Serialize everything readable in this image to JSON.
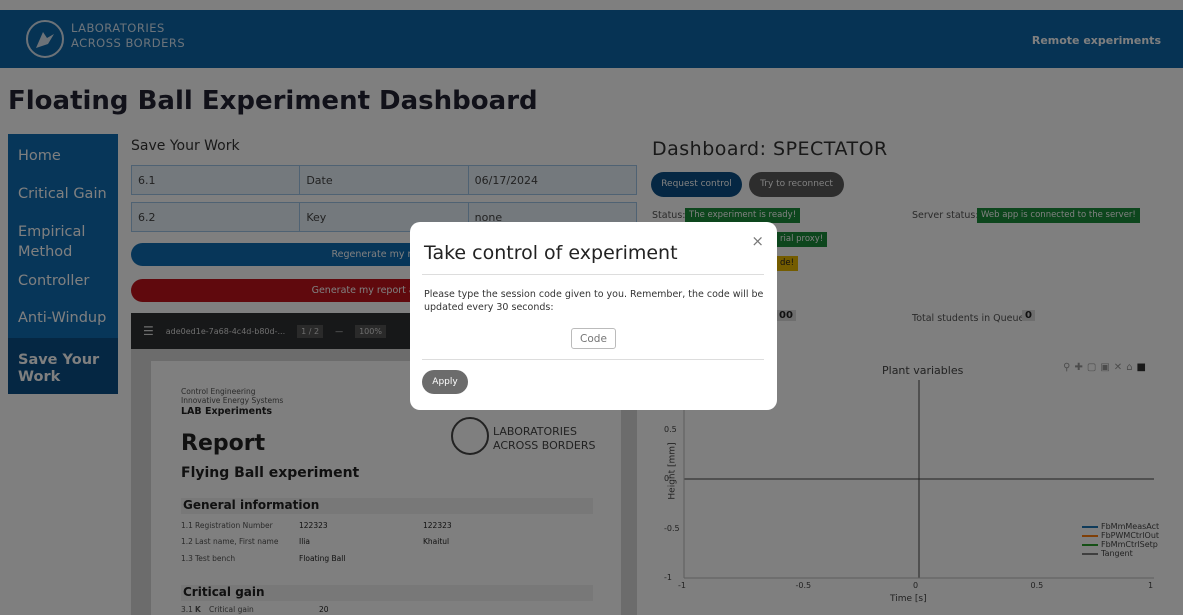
{
  "header": {
    "logo_line1": "LABORATORIES",
    "logo_line2": "ACROSS BORDERS",
    "nav_right": "Remote experiments"
  },
  "page_title": "Floating Ball Experiment Dashboard",
  "sidebar": {
    "items": [
      {
        "label": "Home"
      },
      {
        "label": "Critical Gain"
      },
      {
        "label": "Empirical Method"
      },
      {
        "label": "Controller"
      },
      {
        "label": "Anti-Windup"
      },
      {
        "label": "Save Your Work"
      }
    ]
  },
  "save": {
    "section_title": "Save Your Work",
    "rows": [
      {
        "c1": "6.1",
        "c2": "Date",
        "c3": "06/17/2024"
      },
      {
        "c1": "6.2",
        "c2": "Key",
        "c3": "none"
      }
    ],
    "regen_button": "Regenerate my report",
    "textfile_button": "Generate my report as Textfile"
  },
  "pdf": {
    "filename": "ade0ed1e-7a68-4c4d-b80d-...",
    "page_indicator": "1 / 2",
    "zoom": "100%",
    "line1": "Control Engineering",
    "line2": "Innovative Energy Systems",
    "lab": "LAB Experiments",
    "logo_line1": "LABORATORIES",
    "logo_line2": "ACROSS BORDERS",
    "report": "Report",
    "subtitle": "Flying Ball experiment",
    "general_title": "General information",
    "general_rows": [
      {
        "num": "1.1",
        "label": "Registration Number",
        "v1": "122323",
        "v2": "122323"
      },
      {
        "num": "1.2",
        "label": "Last name, First name",
        "v1": "Ilia",
        "v2": "Khaitul"
      },
      {
        "num": "1.3",
        "label": "Test bench",
        "v1": "Floating Ball",
        "v2": ""
      }
    ],
    "critical_title": "Critical gain",
    "critical_num": "3.1",
    "critical_k": "K",
    "critical_label": "Critical gain",
    "critical_value": "20"
  },
  "dashboard": {
    "title": "Dashboard: SPECTATOR",
    "request_control": "Request control",
    "reconnect": "Try to reconnect",
    "status_label": "Status:",
    "status_value": "The experiment is ready!",
    "server_status_label": "Server status:",
    "server_status_value": "Web app is connected to the server!",
    "proxy_tag": "rial proxy!",
    "yellow_tag": "de!",
    "queue_value_left": "00",
    "queue_label": "Total students in Queue:",
    "queue_count": "0"
  },
  "chart_data": {
    "type": "line",
    "title": "Plant variables",
    "xlabel": "Time [s]",
    "ylabel": "Height [mm]",
    "xlim": [
      -1,
      1
    ],
    "ylim": [
      -1,
      1
    ],
    "x_ticks": [
      "-1",
      "-0.5",
      "0",
      "0.5",
      "1"
    ],
    "y_ticks": [
      "0.5",
      "0",
      "-0.5",
      "-1"
    ],
    "series": [
      {
        "name": "FbMmMeasAct",
        "color": "#1f77b4",
        "values": []
      },
      {
        "name": "FbPWMCtrlOut",
        "color": "#ff7f0e",
        "values": []
      },
      {
        "name": "FbMmCtrlSetp",
        "color": "#2ca02c",
        "values": []
      },
      {
        "name": "Tangent",
        "color": "#7f7f7f",
        "values": []
      }
    ]
  },
  "modal": {
    "title": "Take control of experiment",
    "close": "×",
    "body": "Please type the session code given to you. Remember, the code will be updated every 30 seconds:",
    "code_placeholder": "Code",
    "apply": "Apply"
  }
}
